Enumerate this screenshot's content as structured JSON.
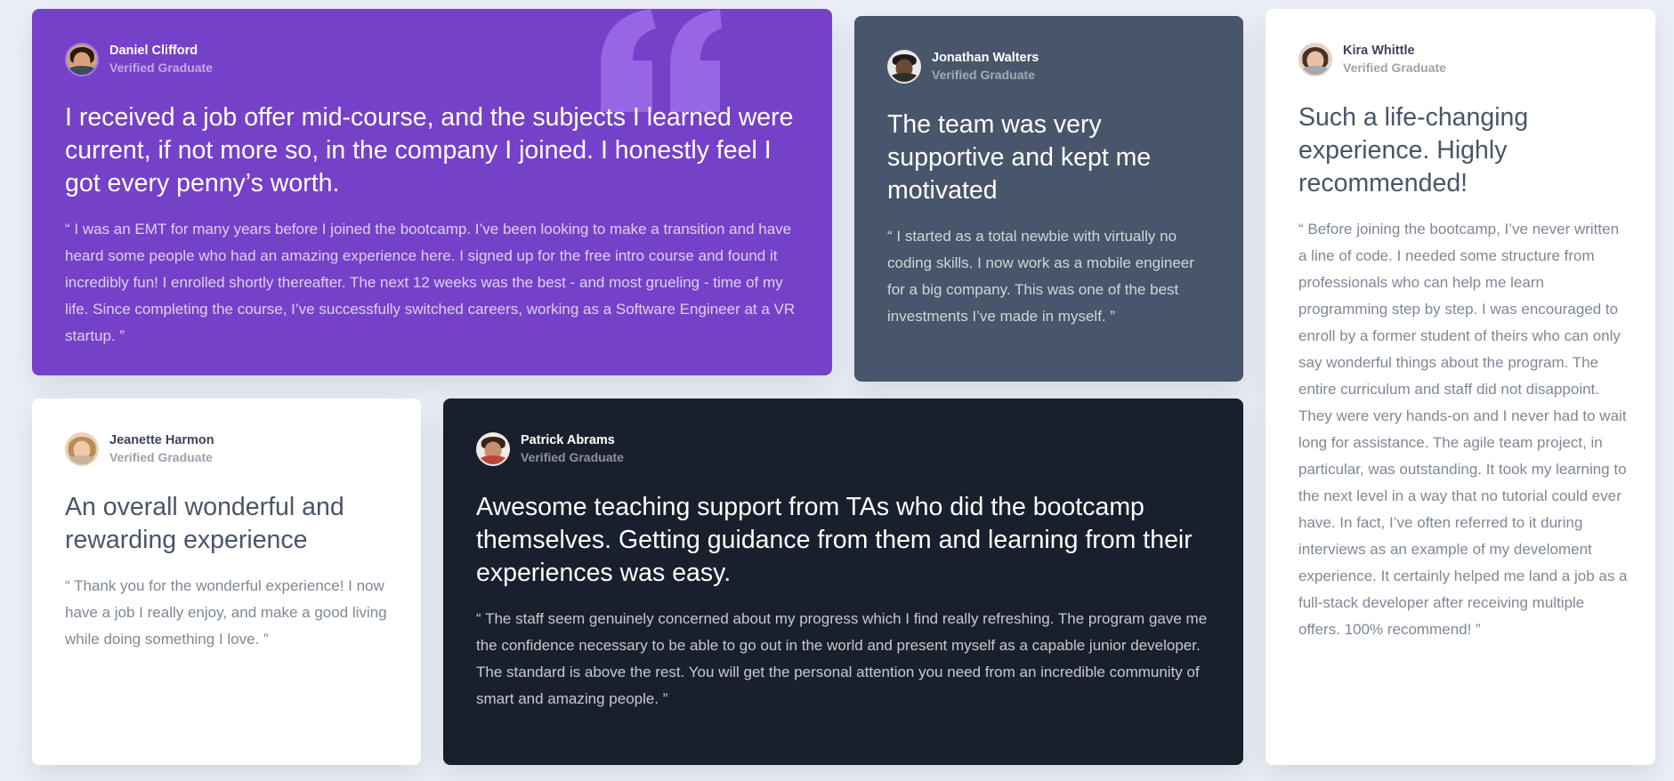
{
  "colors": {
    "background": "#eceff7",
    "purple": "#7541c8",
    "gray": "#48556a",
    "dark": "#19202d",
    "white": "#ffffff",
    "quote_accent": "#9b6ae8"
  },
  "testimonials": [
    {
      "name": "Daniel Clifford",
      "role": "Verified Graduate",
      "headline": "I received a job offer mid-course, and the subjects I learned were current, if not more so, in the company I joined. I honestly feel I got every penny’s worth.",
      "body": "“ I was an EMT for many years before I joined the bootcamp. I’ve been looking to make a transition and have heard some people who had an amazing experience here. I signed up for the free intro course and found it incredibly fun! I enrolled shortly thereafter. The next 12 weeks was the best - and most grueling - time of my life. Since completing the course, I’ve successfully switched careers, working as a Software Engineer at a VR startup. ”"
    },
    {
      "name": "Jonathan Walters",
      "role": "Verified Graduate",
      "headline": "The team was very supportive and kept me motivated",
      "body": "“ I started as a total newbie with virtually no coding skills. I now work as a mobile engineer for a big company. This was one of the best investments I’ve made in myself. ”"
    },
    {
      "name": "Kira Whittle",
      "role": "Verified Graduate",
      "headline": "Such a life-changing experience. Highly recommended!",
      "body": "“ Before joining the bootcamp, I’ve never written a line of code. I needed some structure from professionals who can help me learn programming step by step. I was encouraged to enroll by a former student of theirs who can only say wonderful things about the program. The entire curriculum and staff did not disappoint. They were very hands-on and I never had to wait long for assistance. The agile team project, in particular, was outstanding. It took my learning to the next level in a way that no tutorial could ever have. In fact, I’ve often referred to it during interviews as an example of my develoment experience. It certainly helped me land a job as a full-stack developer after receiving multiple offers. 100% recommend! ”"
    },
    {
      "name": "Jeanette Harmon",
      "role": "Verified Graduate",
      "headline": "An overall wonderful and rewarding experience",
      "body": "“ Thank you for the wonderful experience! I now have a job I really enjoy, and make a good living while doing something I love. ”"
    },
    {
      "name": "Patrick Abrams",
      "role": "Verified Graduate",
      "headline": "Awesome teaching support from TAs who did the bootcamp themselves. Getting guidance from them and learning from their experiences was easy.",
      "body": "“ The staff seem genuinely concerned about my progress which I find really refreshing. The program gave me the confidence necessary to be able to go out in the world and present myself as a capable junior developer. The standard is above the rest. You will get the personal attention you need from an incredible community of smart and amazing people. ”"
    }
  ]
}
